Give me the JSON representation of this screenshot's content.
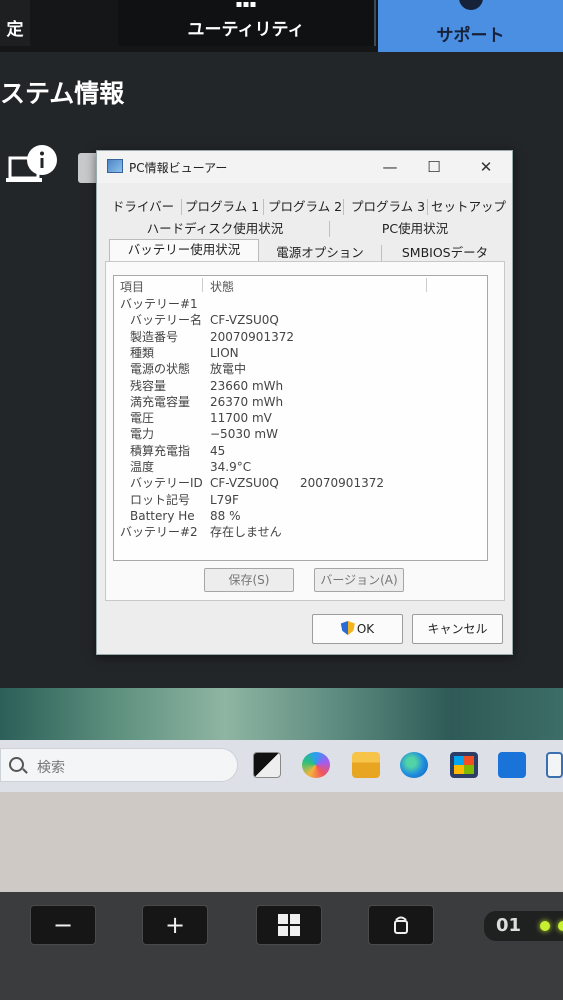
{
  "app_header": {
    "left_tab": "定",
    "utility_tab": "ユーティリティ",
    "support_tab": "サポート",
    "section_title": "ステム情報"
  },
  "dialog": {
    "title": "PC情報ビューアー",
    "tabs_row1": [
      "ドライバー",
      "プログラム 1",
      "プログラム 2",
      "プログラム 3",
      "セットアップ"
    ],
    "tabs_row2": [
      "ハードディスク使用状況",
      "PC使用状況"
    ],
    "tabs_row3": [
      "バッテリー使用状況",
      "電源オプション",
      "SMBIOSデータ"
    ],
    "active_tab": "バッテリー使用状況",
    "list_headers": {
      "item": "項目",
      "state": "状態"
    },
    "rows": [
      {
        "key": "バッテリー#1",
        "value": "",
        "indent": false
      },
      {
        "key": "バッテリー名",
        "value": "CF-VZSU0Q",
        "indent": true
      },
      {
        "key": "製造番号",
        "value": "20070901372",
        "indent": true
      },
      {
        "key": "種類",
        "value": "LION",
        "indent": true
      },
      {
        "key": "電源の状態",
        "value": "放電中",
        "indent": true
      },
      {
        "key": "残容量",
        "value": "23660 mWh",
        "indent": true
      },
      {
        "key": "満充電容量",
        "value": "26370 mWh",
        "indent": true
      },
      {
        "key": "電圧",
        "value": "11700 mV",
        "indent": true
      },
      {
        "key": "電力",
        "value": "−5030 mW",
        "indent": true
      },
      {
        "key": "積算充電指",
        "value": "45",
        "indent": true
      },
      {
        "key": "温度",
        "value": "34.9°C",
        "indent": true
      },
      {
        "key": "バッテリーID",
        "value": "CF-VZSU0Q",
        "value2": "20070901372",
        "indent": true
      },
      {
        "key": "ロット記号",
        "value": "L79F",
        "indent": true
      },
      {
        "key": "Battery He",
        "value": "88 %",
        "indent": true
      },
      {
        "key": "バッテリー#2",
        "value": "存在しません",
        "indent": false
      }
    ],
    "save_button": "保存(S)",
    "version_button": "バージョン(A)",
    "ok_button": "OK",
    "cancel_button": "キャンセル"
  },
  "taskbar": {
    "search_placeholder": "検索"
  },
  "keys": {
    "minus": "−",
    "plus": "+"
  },
  "status": {
    "battery_text": "01"
  },
  "colors": {
    "accent": "#4b8fe3",
    "led": "#c7f032"
  }
}
